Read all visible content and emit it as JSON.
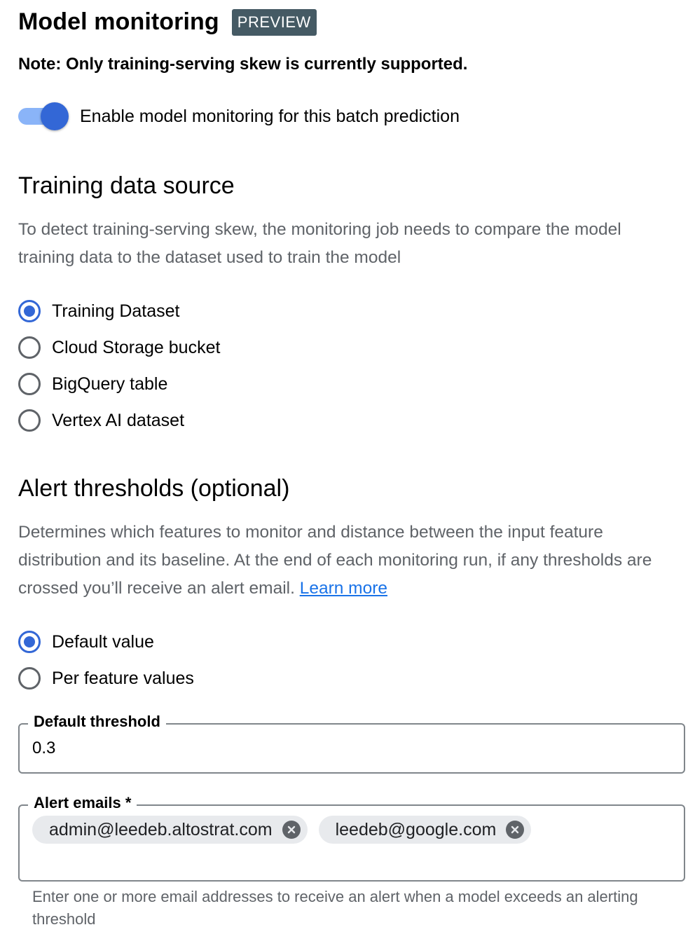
{
  "header": {
    "title": "Model monitoring",
    "badge": "PREVIEW"
  },
  "note": "Note: Only training-serving skew is currently supported.",
  "toggle": {
    "label": "Enable model monitoring for this batch prediction",
    "enabled": true
  },
  "training_source": {
    "title": "Training data source",
    "description": "To detect training-serving skew, the monitoring job needs to compare the model training data to the dataset used to train the model",
    "options": [
      {
        "label": "Training Dataset",
        "selected": true
      },
      {
        "label": "Cloud Storage bucket",
        "selected": false
      },
      {
        "label": "BigQuery table",
        "selected": false
      },
      {
        "label": "Vertex AI dataset",
        "selected": false
      }
    ]
  },
  "alert_thresholds": {
    "title": "Alert thresholds (optional)",
    "description": "Determines which features to monitor and distance between the input feature distribution and its baseline. At the end of each monitoring run, if any thresholds are crossed you’ll receive an alert email.",
    "learn_more": "Learn more",
    "options": [
      {
        "label": "Default value",
        "selected": true
      },
      {
        "label": "Per feature values",
        "selected": false
      }
    ]
  },
  "default_threshold": {
    "label": "Default threshold",
    "value": "0.3"
  },
  "alert_emails": {
    "label": "Alert emails *",
    "emails": [
      "admin@leedeb.altostrat.com",
      "leedeb@google.com"
    ],
    "helper": "Enter one or more email addresses to receive an alert when a model exceeds an alerting threshold"
  },
  "colors": {
    "accent": "#3367d6",
    "badge": "#455a64",
    "link": "#1a73e8",
    "toggle_track": "#8ab4f8"
  }
}
